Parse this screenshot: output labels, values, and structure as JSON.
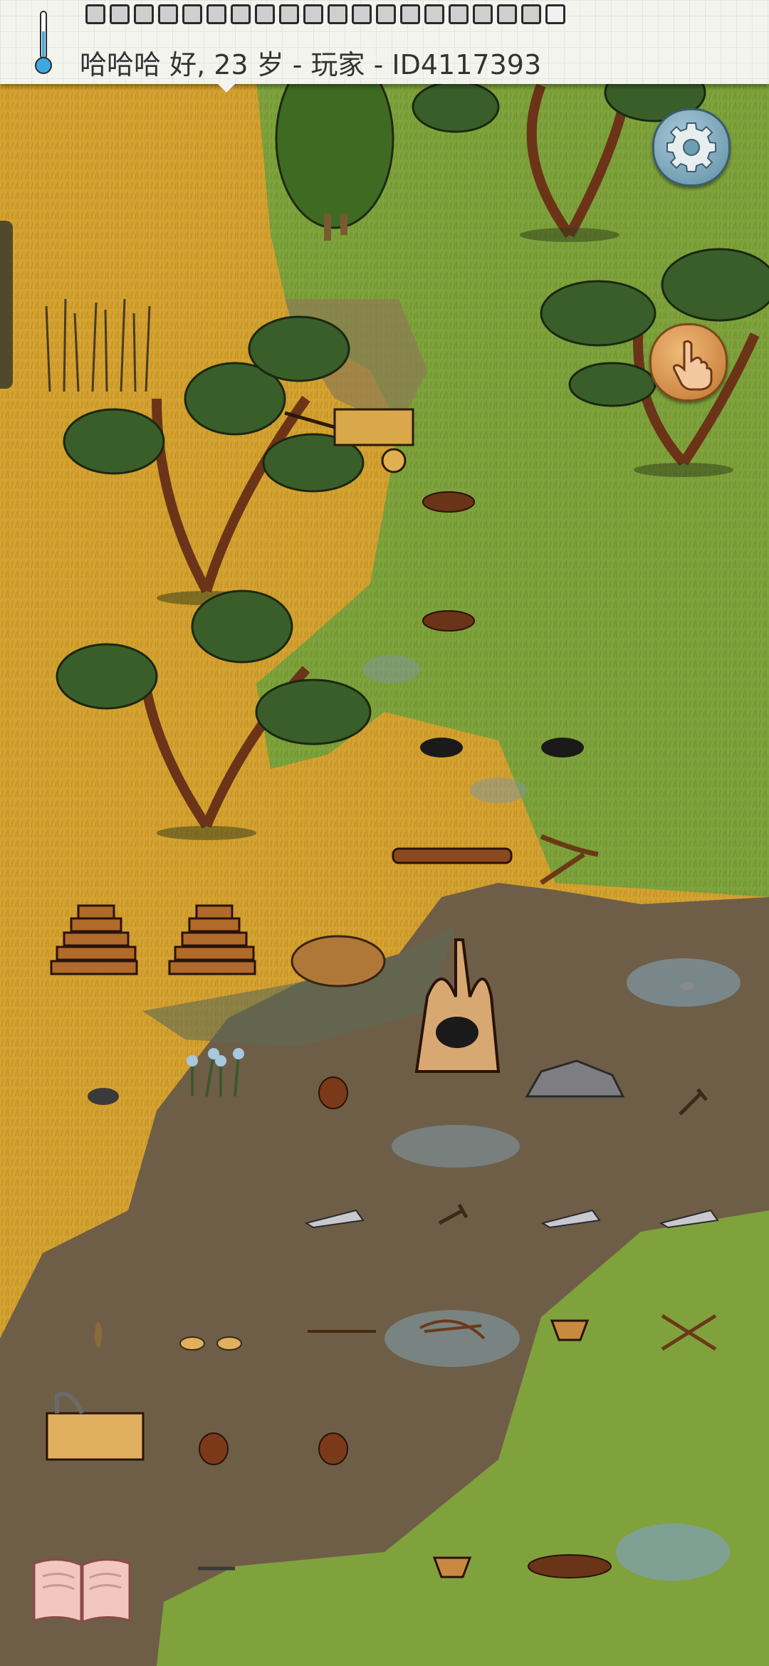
{
  "hud": {
    "status_text": "哈哈哈 好, 23 岁 - 玩家 - ID4117393",
    "icons": {
      "thermometer": "thermometer-icon",
      "settings": "gear-icon",
      "interact": "pointing-hand-icon",
      "tech_tree": "open-book-icon"
    }
  },
  "colors": {
    "dry_grass": "#d4a230",
    "green_grass": "#7fa23c",
    "mud": "#6e5e48",
    "water": "#7f96a0",
    "hud_bg": "#f4f4ee",
    "settings_btn": "#6f9db2",
    "hand_btn": "#d08a40"
  }
}
